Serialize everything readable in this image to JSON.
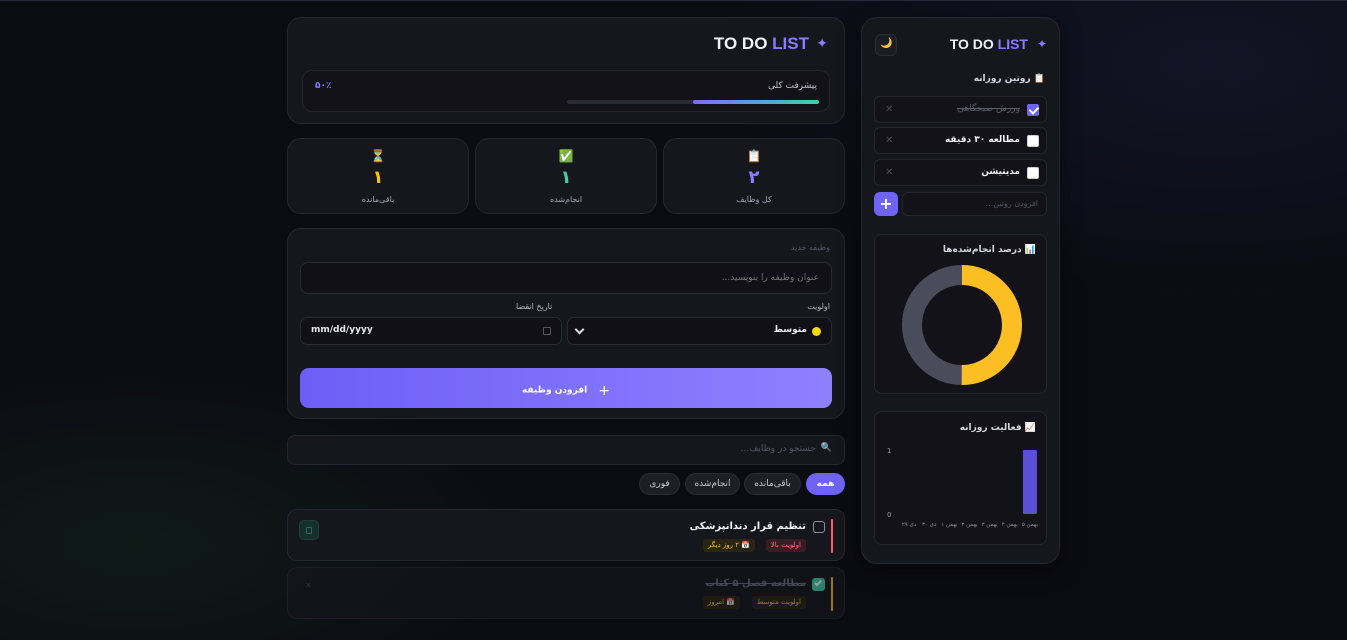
{
  "header": {
    "title_main": "TO DO",
    "title_accent": "LIST",
    "sparkle": "✦"
  },
  "progress": {
    "label": "پیشرفت کلی",
    "value_text": "۵۰٪",
    "fraction": 0.5
  },
  "stats": [
    {
      "icon": "📋",
      "value": "۲",
      "label": "کل وظایف",
      "color": "#8b7cff"
    },
    {
      "icon": "✅",
      "value": "۱",
      "label": "انجام‌شده",
      "color": "#3fd0a8"
    },
    {
      "icon": "⏳",
      "value": "۱",
      "label": "باقی‌مانده",
      "color": "#f5c518"
    }
  ],
  "new_task": {
    "section_label": "وظیفه جدید",
    "title_placeholder": "عنوان وظیفه را بنویسید...",
    "priority_label": "اولویت",
    "priority_value": "متوسط",
    "deadline_label": "تاریخ انقضا",
    "date_value": "mm/dd/yyyy",
    "add_button": "افزودن وظیفه",
    "add_icon": "+"
  },
  "search": {
    "placeholder": "جستجو در وظایف...",
    "icon": "🔍"
  },
  "filters": [
    {
      "label": "همه",
      "active": true
    },
    {
      "label": "باقی‌مانده",
      "active": false
    },
    {
      "label": "انجام‌شده",
      "active": false
    },
    {
      "label": "فوری",
      "active": false
    }
  ],
  "tasks": [
    {
      "title": "تنظیم قرار دندانپزشکی",
      "done": false,
      "priority_tag": "اولویت بالا",
      "due_tag": "📅 ۲ روز دیگر",
      "bar_color": "#ff5a6a"
    },
    {
      "title": "مطالعه فصل ۵ کتاب",
      "done": true,
      "priority_tag": "اولویت متوسط",
      "due_tag": "📅 امروز",
      "bar_color": "#f5c518"
    }
  ],
  "sidebar": {
    "title_main": "TO DO",
    "title_accent": "LIST",
    "moon_icon": "🌙",
    "routines_title": "📋 روتین روزانه",
    "routines": [
      {
        "label": "ورزش صبحگاهی",
        "done": true
      },
      {
        "label": "مطالعه ۳۰ دقیقه",
        "done": false
      },
      {
        "label": "مدیتیشن",
        "done": false
      }
    ],
    "add_routine_placeholder": "افزودن روتین...",
    "remove_glyph": "✕",
    "donut_title": "📊 درصد انجام‌شده‌ها",
    "donut": {
      "done_fraction": 0.5,
      "done_color": "#fbbf24",
      "rest_color": "#4b4b5c"
    },
    "activity_title": "📈 فعالیت روزانه",
    "activity": {
      "y_ticks": [
        "1",
        "0"
      ],
      "x_labels": [
        "۵ بهمن",
        "۴ بهمن",
        "۳ بهمن",
        "۲ بهمن",
        "۱ بهمن",
        "۳۰ دی",
        "۲۹ دی"
      ],
      "values": [
        1,
        0,
        0,
        0,
        0,
        0,
        0
      ],
      "ylim": [
        0,
        1
      ],
      "bar_color": "#5b4fd6"
    }
  }
}
